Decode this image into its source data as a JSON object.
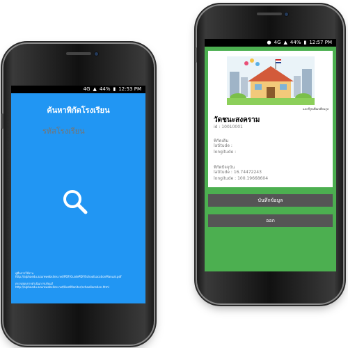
{
  "left_screen": {
    "status": {
      "network": "4G",
      "battery": "44%",
      "time": "12:53 PM"
    },
    "title": "ค้นหาพิกัดโรงเรียน",
    "search_input_placeholder": "รหัสโรงเรียน",
    "footer": {
      "manual_label": "คู่มือการใช้งาน",
      "manual_url": "http://alphaedu.azurewebsites.net/PDF/GuidePDF/SchoolLocationManual.pdf",
      "edit_label": "ตรวจสอบการดำเนินการปรับแก้",
      "edit_url": "http://alphaedu.azurewebsites.net/HostMonitor/schoollocation.html"
    },
    "colors": {
      "background": "#2196f3"
    }
  },
  "right_screen": {
    "status": {
      "network": "4G",
      "battery": "44%",
      "time": "12:57 PM"
    },
    "image_credit": "และที่รูปเพื่อเปลี่ยนรูป",
    "school_name": "วัดชนะสงคราม",
    "school_id": "id : 10010001",
    "old_location": {
      "heading": "พิกัดเดิม",
      "latitude": "latitude :",
      "longitude": "longitude :"
    },
    "current_location": {
      "heading": "พิกัดปัจจุบัน",
      "latitude": "latitude : 16.74472243",
      "longitude": "longitude : 100.19668604"
    },
    "save_button": "บันทึกข้อมูล",
    "exit_button": "ออก",
    "colors": {
      "background": "#4caf50",
      "button": "#555555"
    }
  }
}
